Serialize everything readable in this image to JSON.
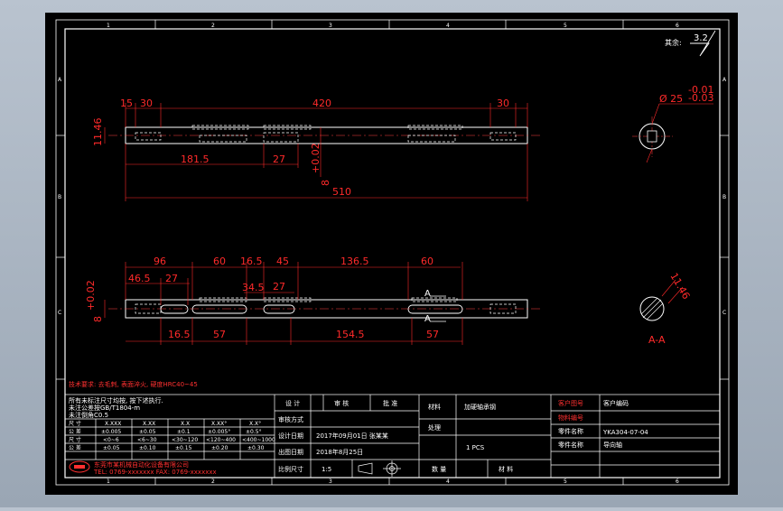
{
  "drawing": {
    "zone_columns": [
      "1",
      "2",
      "3",
      "4",
      "5",
      "6"
    ],
    "zone_rows": [
      "A",
      "B",
      "C"
    ],
    "roughness": {
      "label": "其余:",
      "value": "3.2"
    },
    "top_view": {
      "dims_top": [
        "15",
        "30",
        "420",
        "30"
      ],
      "dim_left": "11.46",
      "dims_mid": [
        "181.5",
        "27"
      ],
      "dim_vert": "8",
      "dim_tol": "+0.02",
      "dim_total": "510"
    },
    "bottom_view": {
      "dims_top": [
        "96",
        "60",
        "16.5",
        "45",
        "136.5",
        "60"
      ],
      "dims_second": [
        "46.5",
        "27"
      ],
      "dims_inner": [
        "34.5",
        "27"
      ],
      "dim_vert": "8",
      "dim_tol": "+0.02",
      "dims_bottom": [
        "16.5",
        "57",
        "154.5",
        "57"
      ],
      "section_mark": "A"
    },
    "section_top": {
      "dia": "Ø 25",
      "tol_upper": "-0.01",
      "tol_lower": "-0.03"
    },
    "section_bottom": {
      "dim": "11.46",
      "label": "A-A"
    },
    "note_red": "技术要求: 去毛刺, 表面淬火, 硬度HRC40~45",
    "title_block": {
      "notes": [
        "所有未标注尺寸均按, 按下述执行.",
        "未注公差按GB/T1804-m",
        "未注倒角C0.5"
      ],
      "tol_headers": [
        "尺 寸",
        "X.XXX",
        "X.XX",
        "X.X",
        "X.XX°",
        "X.X°"
      ],
      "tol_row1": [
        "公 差",
        "±0.005",
        "±0.05",
        "±0.1",
        "±0.005°",
        "±0.5°"
      ],
      "tol_row2_head": "尺 寸",
      "tol_row2": [
        "<0~6",
        "<6~30",
        "<30~120",
        "<120~400",
        "<400~1000"
      ],
      "tol_row3_head": "公 差",
      "tol_row3": [
        "±0.05",
        "±0.10",
        "±0.15",
        "±0.20",
        "±0.30"
      ],
      "company": "东莞市某机械自动化设备有限公司",
      "company_sub": "TEL: 0769-xxxxxxx FAX: 0769-xxxxxxx",
      "sig_headers": [
        "设 计",
        "审 核",
        "批 准"
      ],
      "labels_left": [
        "审核方式",
        "设计日期",
        "出图日期",
        "比例尺寸"
      ],
      "design_date": "2017年09月01日  张某某",
      "print_date": "2018年8月25日",
      "scale": "1:5",
      "material_label": "材料",
      "material_value": "加硬轴承钢",
      "treatment_label": "处理",
      "qty": "1  PCS",
      "qty_labels": [
        "数 量",
        "材 料"
      ],
      "right_labels": [
        "客户图号",
        "物料编号",
        "零件名称",
        "零件名称"
      ],
      "right_values": [
        "客户编码",
        "YKA304-07-04",
        "导向轴",
        ""
      ]
    }
  }
}
